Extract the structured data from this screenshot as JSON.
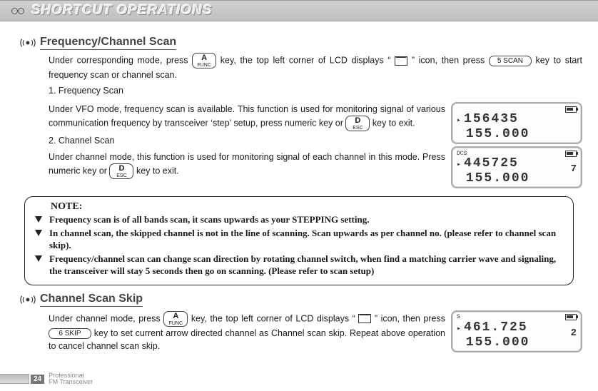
{
  "banner": {
    "title": "SHORTCUT OPERATIONS"
  },
  "sec1": {
    "title": "Frequency/Channel Scan",
    "p1a": "Under corresponding mode, press ",
    "p1b": " key, the top left corner of LCD displays “ ",
    "p1c": " ” icon, then press ",
    "p1d": " key to start frequency scan or channel scan.",
    "l1": "1. Frequency Scan",
    "p2a": "Under VFO mode, frequency scan is available. This function is used for monitoring signal of various communication frequency by transceiver ‘step’ setup, press numeric key or ",
    "p2b": " key to exit.",
    "l2": "2. Channel Scan",
    "p3a": "Under channel mode, this function is used for monitoring signal of each channel in this mode. Press numeric key or ",
    "p3b": " key to exit."
  },
  "keys": {
    "a_func_top": "A",
    "a_func_bot": "FUNC",
    "five_scan": "5 SCAN",
    "d_esc_top": "D",
    "d_esc_bot": "ESC",
    "six_skip": "6 SKIP"
  },
  "lcd1": {
    "top": "",
    "r1": "156435",
    "r2": "155.000"
  },
  "lcd2": {
    "top": "DCS",
    "r1": "445725",
    "r2": "155.000",
    "rn": "7"
  },
  "lcd3": {
    "top": "S",
    "r1": "461.725",
    "r2": "155.000",
    "rn": "2"
  },
  "note": {
    "title": "NOTE:",
    "i1": "Frequency scan is of all bands scan, it scans upwards as your STEPPING setting.",
    "i2": "In channel scan, the skipped channel is not in the line of scanning. Scan upwards as per channel no. (please refer to channel scan skip).",
    "i3": "Frequency/channel scan can change scan direction by rotating channel switch, when find a matching carrier wave and signaling, the transceiver will stay 5 seconds then go on scanning. (Please refer to scan setup)"
  },
  "sec2": {
    "title": "Channel Scan Skip",
    "p1a": "Under channel mode, press ",
    "p1b": " key, the top left corner of LCD displays “ ",
    "p1c": " ” icon, then press ",
    "p1d": " key to set current arrow directed channel as Channel scan skip. Repeat above operation to cancel channel scan skip."
  },
  "footer": {
    "page": "24",
    "l1": "Professional",
    "l2": "FM Transceiver"
  }
}
